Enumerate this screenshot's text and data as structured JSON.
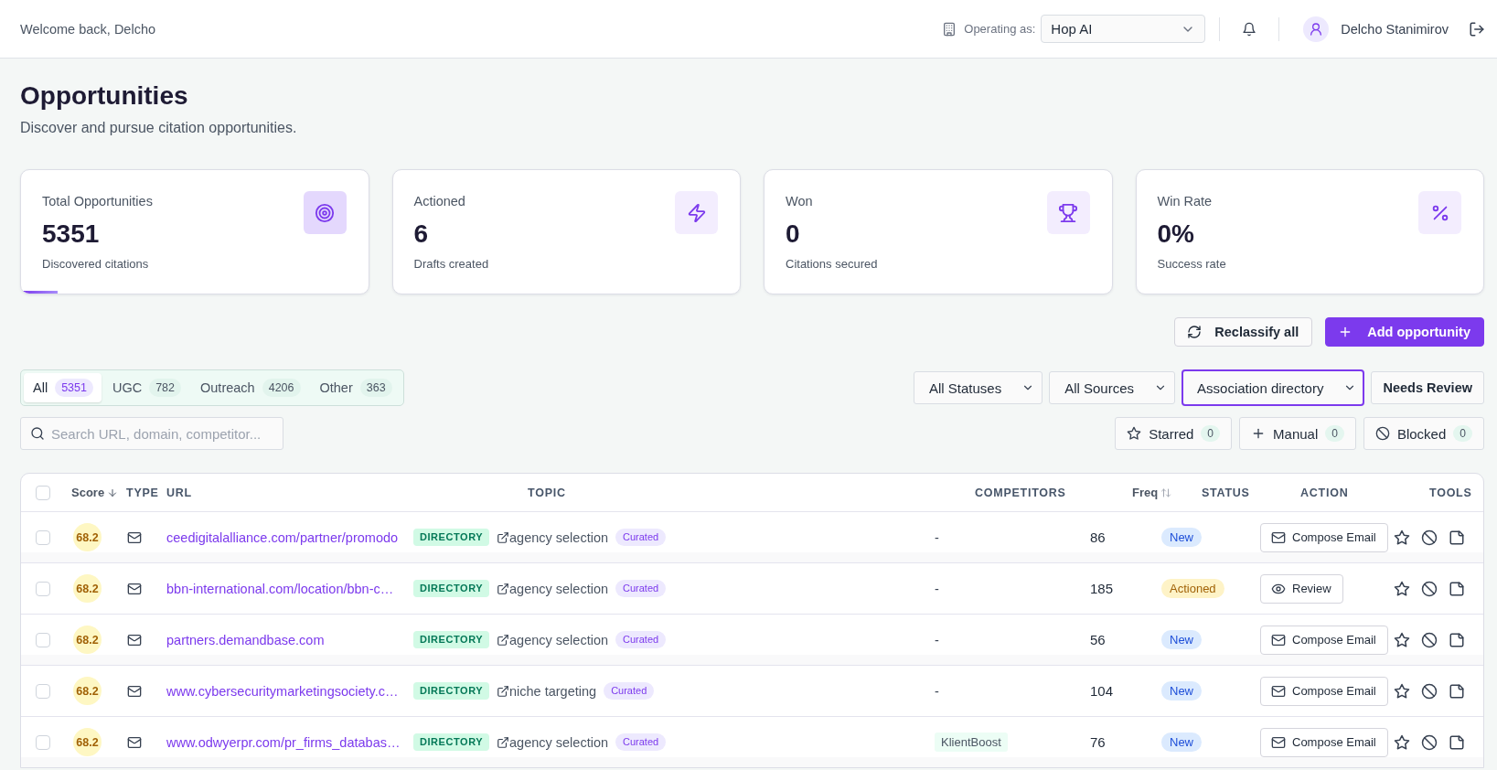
{
  "header": {
    "greeting": "Welcome back, Delcho",
    "operating_label": "Operating as:",
    "operating_value": "Hop AI",
    "user_name": "Delcho Stanimirov"
  },
  "page": {
    "title": "Opportunities",
    "subtitle": "Discover and pursue citation opportunities."
  },
  "stats": [
    {
      "label": "Total Opportunities",
      "value": "5351",
      "note": "Discovered citations",
      "selected": true
    },
    {
      "label": "Actioned",
      "value": "6",
      "note": "Drafts created",
      "selected": false
    },
    {
      "label": "Won",
      "value": "0",
      "note": "Citations secured",
      "selected": false
    },
    {
      "label": "Win Rate",
      "value": "0%",
      "note": "Success rate",
      "selected": false
    }
  ],
  "actions": [
    {
      "label": "Reclassify all",
      "kind": "secondary"
    },
    {
      "label": "Add opportunity",
      "kind": "primary"
    }
  ],
  "category_tabs": [
    {
      "label": "All",
      "count": "5351",
      "selected": true
    },
    {
      "label": "UGC",
      "count": "782",
      "selected": false
    },
    {
      "label": "Outreach",
      "count": "4206",
      "selected": false
    },
    {
      "label": "Other",
      "count": "363",
      "selected": false
    }
  ],
  "filters": [
    {
      "value": "All Statuses",
      "focused": false
    },
    {
      "value": "All Sources",
      "focused": false
    },
    {
      "value": "Association directory",
      "focused": true
    }
  ],
  "review_toggle": {
    "label": "Needs Review"
  },
  "search": {
    "placeholder": "Search URL, domain, competitor..."
  },
  "quick_filters": [
    {
      "label": "Starred",
      "count": "0"
    },
    {
      "label": "Manual",
      "count": "0"
    },
    {
      "label": "Blocked",
      "count": "0"
    }
  ],
  "table": {
    "all_checked": false,
    "columns": [
      {
        "label": "Score",
        "sortable": true,
        "sorted": true
      },
      {
        "label": "TYPE",
        "sortable": false
      },
      {
        "label": "URL",
        "sortable": false
      },
      {
        "label": "TOPIC",
        "sortable": false
      },
      {
        "label": "COMPETITORS",
        "sortable": false
      },
      {
        "label": "Freq",
        "sortable": true,
        "sorted": false
      },
      {
        "label": "STATUS",
        "sortable": false
      },
      {
        "label": "ACTION",
        "sortable": false
      },
      {
        "label": "TOOLS",
        "sortable": false
      }
    ],
    "rows": [
      {
        "checked": false,
        "score": "68.2",
        "url": "ceedigitalalliance.com/partner/promodo",
        "url_tag": "DIRECTORY",
        "topic": "agency selection",
        "topic_tag": "Curated",
        "competitor": {
          "label": "-",
          "kind": "none"
        },
        "freq": "86",
        "status": {
          "label": "New",
          "kind": "new"
        },
        "action": {
          "label": "Compose Email",
          "kind": "email"
        },
        "starred": false
      },
      {
        "checked": false,
        "score": "68.2",
        "url": "bbn-international.com/location/bbn-c…",
        "url_tag": "DIRECTORY",
        "topic": "agency selection",
        "topic_tag": "Curated",
        "competitor": {
          "label": "-",
          "kind": "none"
        },
        "freq": "185",
        "status": {
          "label": "Actioned",
          "kind": "actioned"
        },
        "action": {
          "label": "Review",
          "kind": "review"
        },
        "starred": false
      },
      {
        "checked": false,
        "score": "68.2",
        "url": "partners.demandbase.com",
        "url_tag": "DIRECTORY",
        "topic": "agency selection",
        "topic_tag": "Curated",
        "competitor": {
          "label": "-",
          "kind": "none"
        },
        "freq": "56",
        "status": {
          "label": "New",
          "kind": "new"
        },
        "action": {
          "label": "Compose Email",
          "kind": "email"
        },
        "starred": false
      },
      {
        "checked": false,
        "score": "68.2",
        "url": "www.cybersecuritymarketingsociety.c…",
        "url_tag": "DIRECTORY",
        "topic": "niche targeting",
        "topic_tag": "Curated",
        "competitor": {
          "label": "-",
          "kind": "none"
        },
        "freq": "104",
        "status": {
          "label": "New",
          "kind": "new"
        },
        "action": {
          "label": "Compose Email",
          "kind": "email"
        },
        "starred": false
      },
      {
        "checked": false,
        "score": "68.2",
        "url": "www.odwyerpr.com/pr_firms_databas…",
        "url_tag": "DIRECTORY",
        "topic": "agency selection",
        "topic_tag": "Curated",
        "competitor": {
          "label": "KlientBoost",
          "kind": "tag"
        },
        "freq": "76",
        "status": {
          "label": "New",
          "kind": "new"
        },
        "action": {
          "label": "Compose Email",
          "kind": "email"
        },
        "starred": false
      }
    ]
  }
}
